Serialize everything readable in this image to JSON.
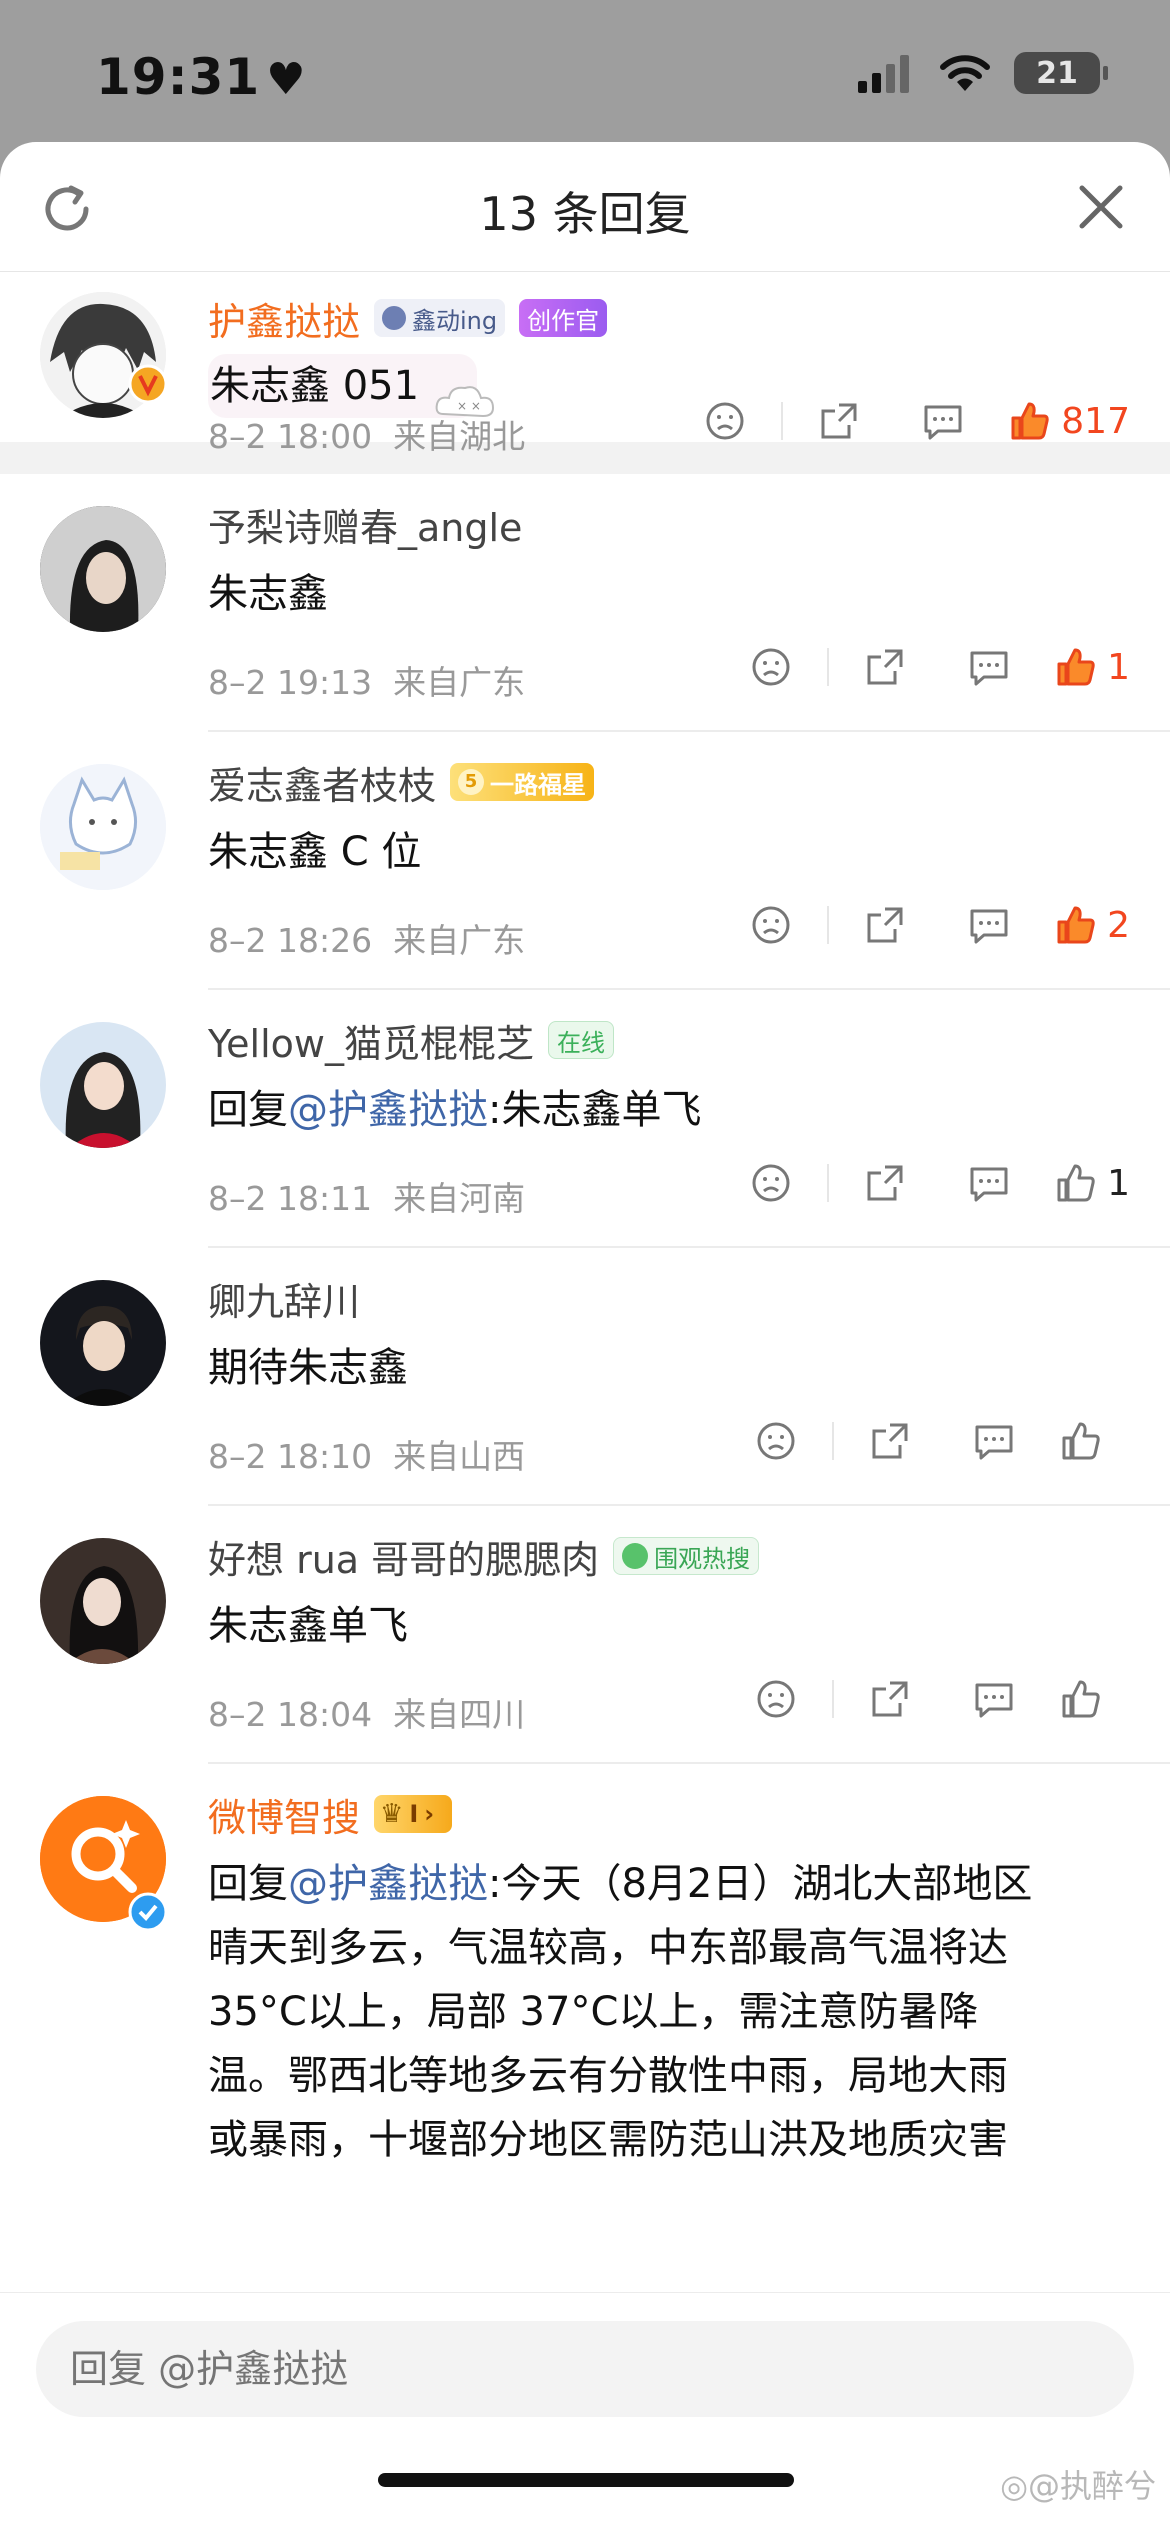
{
  "status_bar": {
    "time": "19:31",
    "battery": "21"
  },
  "header": {
    "title": "13 条回复"
  },
  "colors": {
    "accent_orange": "#f26d1f",
    "like_red": "#f2461f",
    "mention_blue": "#3f66a8"
  },
  "comments": [
    {
      "name": "护鑫挞挞",
      "name_color": "orange",
      "badges": [
        "鑫动ing",
        "创作官"
      ],
      "text": "朱志鑫 051",
      "date": "8–2 18:00",
      "location": "来自湖北",
      "likes": "817",
      "liked": true
    },
    {
      "name": "予梨诗赠春_angle",
      "text": "朱志鑫",
      "date": "8–2 19:13",
      "location": "来自广东",
      "likes": "1",
      "liked": true
    },
    {
      "name": "爱志鑫者枝枝",
      "badges": [
        "一路福星"
      ],
      "text": "朱志鑫 C 位",
      "date": "8–2 18:26",
      "location": "来自广东",
      "likes": "2",
      "liked": true
    },
    {
      "name": "Yellow_猫觅棍棍芝",
      "badges": [
        "在线"
      ],
      "reply_prefix": "回复",
      "mention": "@护鑫挞挞",
      "text": ":朱志鑫单飞",
      "date": "8–2 18:11",
      "location": "来自河南",
      "likes": "1",
      "liked": false
    },
    {
      "name": "卿九辞川",
      "text": "期待朱志鑫",
      "date": "8–2 18:10",
      "location": "来自山西",
      "likes": "",
      "liked": false
    },
    {
      "name": "好想 rua 哥哥的腮腮肉",
      "badges": [
        "围观热搜"
      ],
      "text": "朱志鑫单飞",
      "date": "8–2 18:04",
      "location": "来自四川",
      "likes": "",
      "liked": false
    },
    {
      "name": "微博智搜",
      "name_color": "orange",
      "badges": [
        "I"
      ],
      "reply_prefix": "回复",
      "mention": "@护鑫挞挞",
      "text_lines": [
        ":今天（8月2日）湖北大部地区",
        "晴天到多云，气温较高，中东部最高气温将达",
        "35°C以上，局部 37°C以上，需注意防暑降",
        "温。鄂西北等地多云有分散性中雨，局地大雨",
        "或暴雨，十堰部分地区需防范山洪及地质灾害"
      ]
    }
  ],
  "reply_bar": {
    "placeholder": "回复 @护鑫挞挞"
  },
  "watermark": "@执醉兮"
}
